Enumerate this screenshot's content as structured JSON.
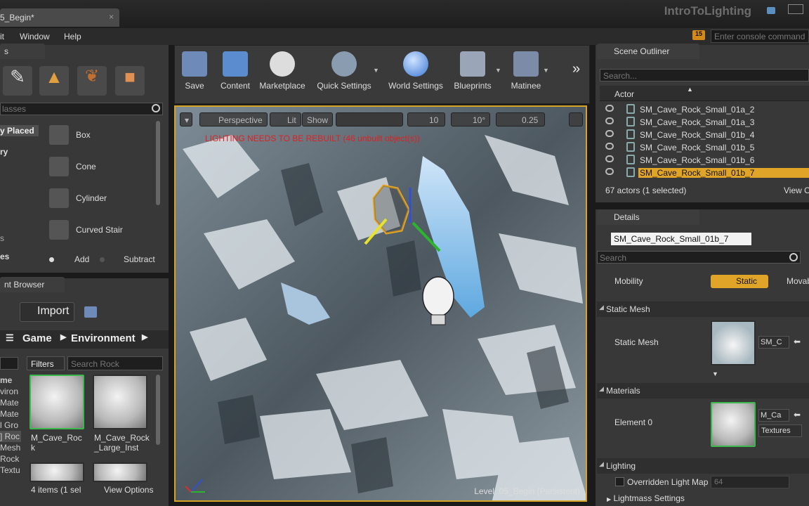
{
  "window": {
    "doc_tab": "5_Begin*",
    "app_title": "IntroToLighting",
    "notif_count": "15"
  },
  "menu": {
    "edit_tail": "it",
    "window": "Window",
    "help": "Help"
  },
  "console": {
    "placeholder": "Enter console command"
  },
  "left": {
    "modes_tab": "s",
    "search_placeholder": "lasses",
    "recently_placed": "y Placed",
    "basic": "ry",
    "volumes": "s",
    "visual": "es",
    "items": [
      {
        "label": "Box"
      },
      {
        "label": "Cone"
      },
      {
        "label": "Cylinder"
      },
      {
        "label": "Curved Stair"
      }
    ],
    "add": "Add",
    "subtract": "Subtract"
  },
  "content_browser": {
    "tab": "nt Browser",
    "import": "Import",
    "path": [
      "Game",
      "Environment"
    ],
    "filters": "Filters",
    "search_placeholder": "Search Rock",
    "tree": [
      "me",
      "viron",
      "Mate",
      "Mate",
      "l Gro",
      "] Roc",
      "Mesh",
      "Rock",
      "Textu"
    ],
    "assets": [
      {
        "name": "M_Cave_Rock"
      },
      {
        "name": "M_Cave_Rock_Large_Inst"
      }
    ],
    "status": "4 items (1 sel",
    "view_options": "View Options"
  },
  "toolbar": {
    "buttons": [
      {
        "label": "Save"
      },
      {
        "label": "Content"
      },
      {
        "label": "Marketplace"
      },
      {
        "label": "Quick Settings"
      },
      {
        "label": "World Settings"
      },
      {
        "label": "Blueprints"
      },
      {
        "label": "Matinee"
      }
    ]
  },
  "viewport": {
    "perspective": "Perspective",
    "lit": "Lit",
    "show": "Show",
    "grid_snap": "10",
    "rot_snap": "10°",
    "scale_snap": "0.25",
    "warning": "LIGHTING NEEDS TO BE REBUILT (46 unbuilt object(s))",
    "level_label": "Level:",
    "level_name": "05_Begin (Persistent)"
  },
  "outliner": {
    "tab": "Scene Outliner",
    "search_placeholder": "Search...",
    "column": "Actor",
    "rows": [
      {
        "name": "SM_Cave_Rock_Small_01a_2"
      },
      {
        "name": "SM_Cave_Rock_Small_01a_3"
      },
      {
        "name": "SM_Cave_Rock_Small_01b_4"
      },
      {
        "name": "SM_Cave_Rock_Small_01b_5"
      },
      {
        "name": "SM_Cave_Rock_Small_01b_6"
      },
      {
        "name": "SM_Cave_Rock_Small_01b_7"
      }
    ],
    "footer": "67 actors (1 selected)",
    "view_options": "View O"
  },
  "details": {
    "tab": "Details",
    "name": "SM_Cave_Rock_Small_01b_7",
    "search_placeholder": "Search",
    "mobility_label": "Mobility",
    "mobility_static": "Static",
    "mobility_movable": "Movab",
    "static_mesh_section": "Static Mesh",
    "static_mesh_label": "Static Mesh",
    "static_mesh_value": "SM_C",
    "materials_section": "Materials",
    "element0_label": "Element 0",
    "element0_value": "M_Ca",
    "textures": "Textures",
    "lighting_section": "Lighting",
    "overridden_lightmap": "Overridden Light Map",
    "lightmap_value": "64",
    "lightmass": "Lightmass Settings"
  }
}
